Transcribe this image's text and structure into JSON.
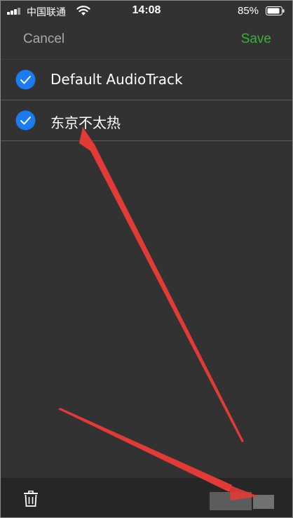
{
  "status_bar": {
    "carrier": "中国联通",
    "time": "14:08",
    "battery": "85%"
  },
  "nav": {
    "cancel_label": "Cancel",
    "save_label": "Save"
  },
  "list": {
    "items": [
      {
        "label": "Default AudioTrack",
        "checked": true
      },
      {
        "label": "东京不太热",
        "checked": true
      }
    ]
  },
  "colors": {
    "background": "#323232",
    "accent_save": "#36b13a",
    "check_blue": "#1a7cf0",
    "arrow_red": "#e23a34"
  },
  "icons": {
    "check": "checkmark-circle-icon",
    "trash": "trash-icon"
  }
}
